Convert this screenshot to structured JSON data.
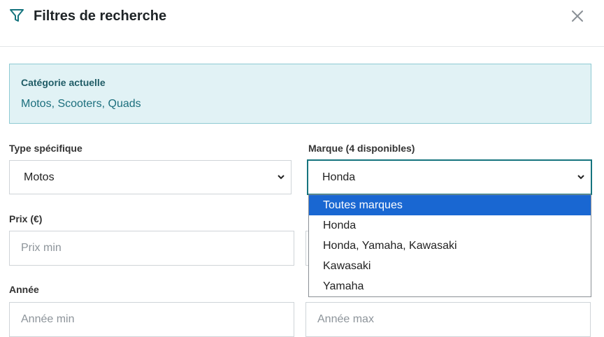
{
  "dialog": {
    "title": "Filtres de recherche",
    "icons": {
      "filter": "filter-icon",
      "close": "close-icon"
    }
  },
  "category": {
    "label": "Catégorie actuelle",
    "value": "Motos, Scooters, Quads"
  },
  "type_field": {
    "label": "Type spécifique",
    "selected": "Motos"
  },
  "brand_field": {
    "label": "Marque (4 disponibles)",
    "selected": "Honda",
    "options": [
      "Toutes marques",
      "Honda",
      "Honda, Yamaha, Kawasaki",
      "Kawasaki",
      "Yamaha"
    ],
    "highlighted_option": "Toutes marques"
  },
  "price_field": {
    "label": "Prix (€)",
    "min_placeholder": "Prix min"
  },
  "year_field": {
    "label": "Année",
    "min_placeholder": "Année min",
    "max_placeholder": "Année max"
  },
  "colors": {
    "accent": "#15747e",
    "category_bg": "#e1f2f5",
    "highlight": "#1967d2"
  }
}
